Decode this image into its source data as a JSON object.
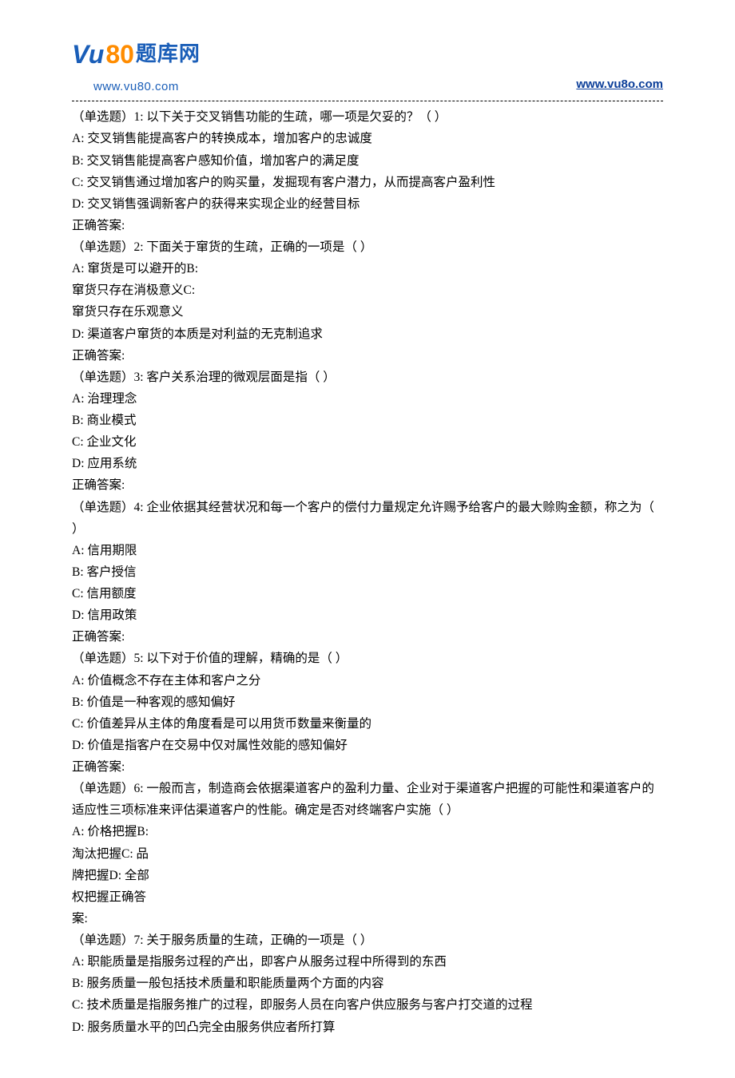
{
  "header": {
    "logo_vu": "Vu",
    "logo_80": "80",
    "logo_text": "题库网",
    "logo_url": "www.vu80.com",
    "link": "www.vu8o.com"
  },
  "questions": [
    {
      "prompt": "（单选题）1: 以下关于交叉销售功能的生疏，哪一项是欠妥的？（ ）",
      "options": [
        "A: 交叉销售能提高客户的转换成本，增加客户的忠诚度",
        "B: 交叉销售能提高客户感知价值，增加客户的满足度",
        "C: 交叉销售通过增加客户的购买量，发掘现有客户潜力，从而提高客户盈利性",
        "D: 交叉销售强调新客户的获得来实现企业的经营目标"
      ],
      "answer_label": "正确答案:"
    },
    {
      "prompt": "（单选题）2: 下面关于窜货的生疏，正确的一项是（ ）",
      "options": [
        "A: 窜货是可以避开的B:",
        "窜货只存在消极意义C:",
        "窜货只存在乐观意义",
        "D: 渠道客户窜货的本质是对利益的无克制追求"
      ],
      "answer_label": "正确答案:"
    },
    {
      "prompt": "（单选题）3: 客户关系治理的微观层面是指（ ）",
      "options": [
        "A: 治理理念",
        "B: 商业模式",
        "C: 企业文化",
        "D: 应用系统"
      ],
      "answer_label": "正确答案:"
    },
    {
      "prompt": "（单选题）4: 企业依据其经营状况和每一个客户的偿付力量规定允许赐予给客户的最大赊购金额，称之为（ ）",
      "options": [
        "A: 信用期限",
        "B: 客户授信",
        "C: 信用额度",
        "D: 信用政策"
      ],
      "answer_label": "正确答案:"
    },
    {
      "prompt": "（单选题）5: 以下对于价值的理解，精确的是（ ）",
      "options": [
        "A: 价值概念不存在主体和客户之分",
        "B: 价值是一种客观的感知偏好",
        "C: 价值差异从主体的角度看是可以用货币数量来衡量的",
        "D: 价值是指客户在交易中仅对属性效能的感知偏好"
      ],
      "answer_label": "正确答案:"
    },
    {
      "prompt": "（单选题）6: 一般而言，制造商会依据渠道客户的盈利力量、企业对于渠道客户把握的可能性和渠道客户的适应性三项标准来评估渠道客户的性能。确定是否对终端客户实施（ ）",
      "options": [
        "A: 价格把握B:",
        "淘汰把握C: 品",
        "牌把握D: 全部",
        "权把握正确答",
        "案:"
      ],
      "answer_label": ""
    },
    {
      "prompt": "（单选题）7: 关于服务质量的生疏，正确的一项是（ ）",
      "options": [
        "A: 职能质量是指服务过程的产出，即客户从服务过程中所得到的东西",
        "B: 服务质量一般包括技术质量和职能质量两个方面的内容",
        "C: 技术质量是指服务推广的过程，即服务人员在向客户供应服务与客户打交道的过程",
        "D: 服务质量水平的凹凸完全由服务供应者所打算"
      ],
      "answer_label": ""
    }
  ]
}
